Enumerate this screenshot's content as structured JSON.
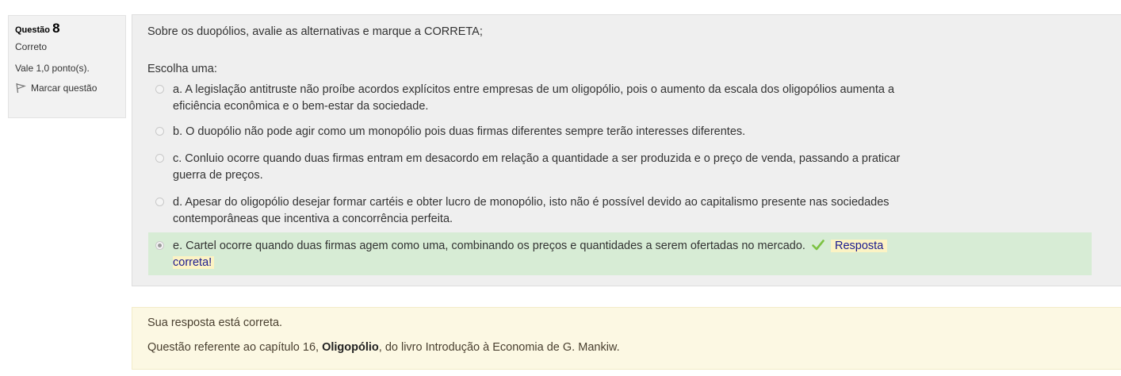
{
  "info": {
    "question_prefix": "Questão",
    "question_number": "8",
    "state": "Correto",
    "grade": "Vale 1,0 ponto(s).",
    "flag_label": "Marcar questão"
  },
  "question": {
    "text": "Sobre os duopólios, avalie as alternativas e marque a CORRETA;",
    "prompt": "Escolha uma:",
    "answers": [
      {
        "line1": "a. A legislação antitruste não proíbe acordos explícitos entre empresas de um oligopólio, pois o aumento da escala dos oligopólios aumenta a",
        "line2": "eficiência econômica e o bem-estar da sociedade.",
        "checked": false
      },
      {
        "line1": "b. O duopólio não pode agir como um monopólio pois duas firmas diferentes sempre terão interesses diferentes.",
        "line2": "",
        "checked": false
      },
      {
        "line1": "c. Conluio ocorre quando duas firmas entram em desacordo em relação a quantidade a ser produzida e o preço de venda, passando a praticar",
        "line2": "guerra de preços.",
        "checked": false
      },
      {
        "line1": "d. Apesar do oligopólio desejar formar cartéis e obter lucro de monopólio, isto não é possível devido ao capitalismo presente nas sociedades",
        "line2": "contemporâneas que incentiva a concorrência perfeita.",
        "checked": false
      },
      {
        "line1": "e. Cartel ocorre quando duas firmas agem como uma, combinando os preços e quantidades a serem ofertadas no mercado.",
        "line2": "",
        "checked": true
      }
    ],
    "feedback_line1": "Resposta",
    "feedback_line2": "correta!"
  },
  "outcome": {
    "line1": "Sua resposta está correta.",
    "line2_pre": "Questão referente ao capítulo 16, ",
    "line2_bold": "Oligopólio",
    "line2_post": ", do livro Introdução à Economia de G. Mankiw."
  },
  "colors": {
    "correct_bg": "#d7ecd5",
    "feedback_bg": "#fcf3c4",
    "outcome_bg": "#fcf8e3",
    "tick": "#7cc242"
  }
}
